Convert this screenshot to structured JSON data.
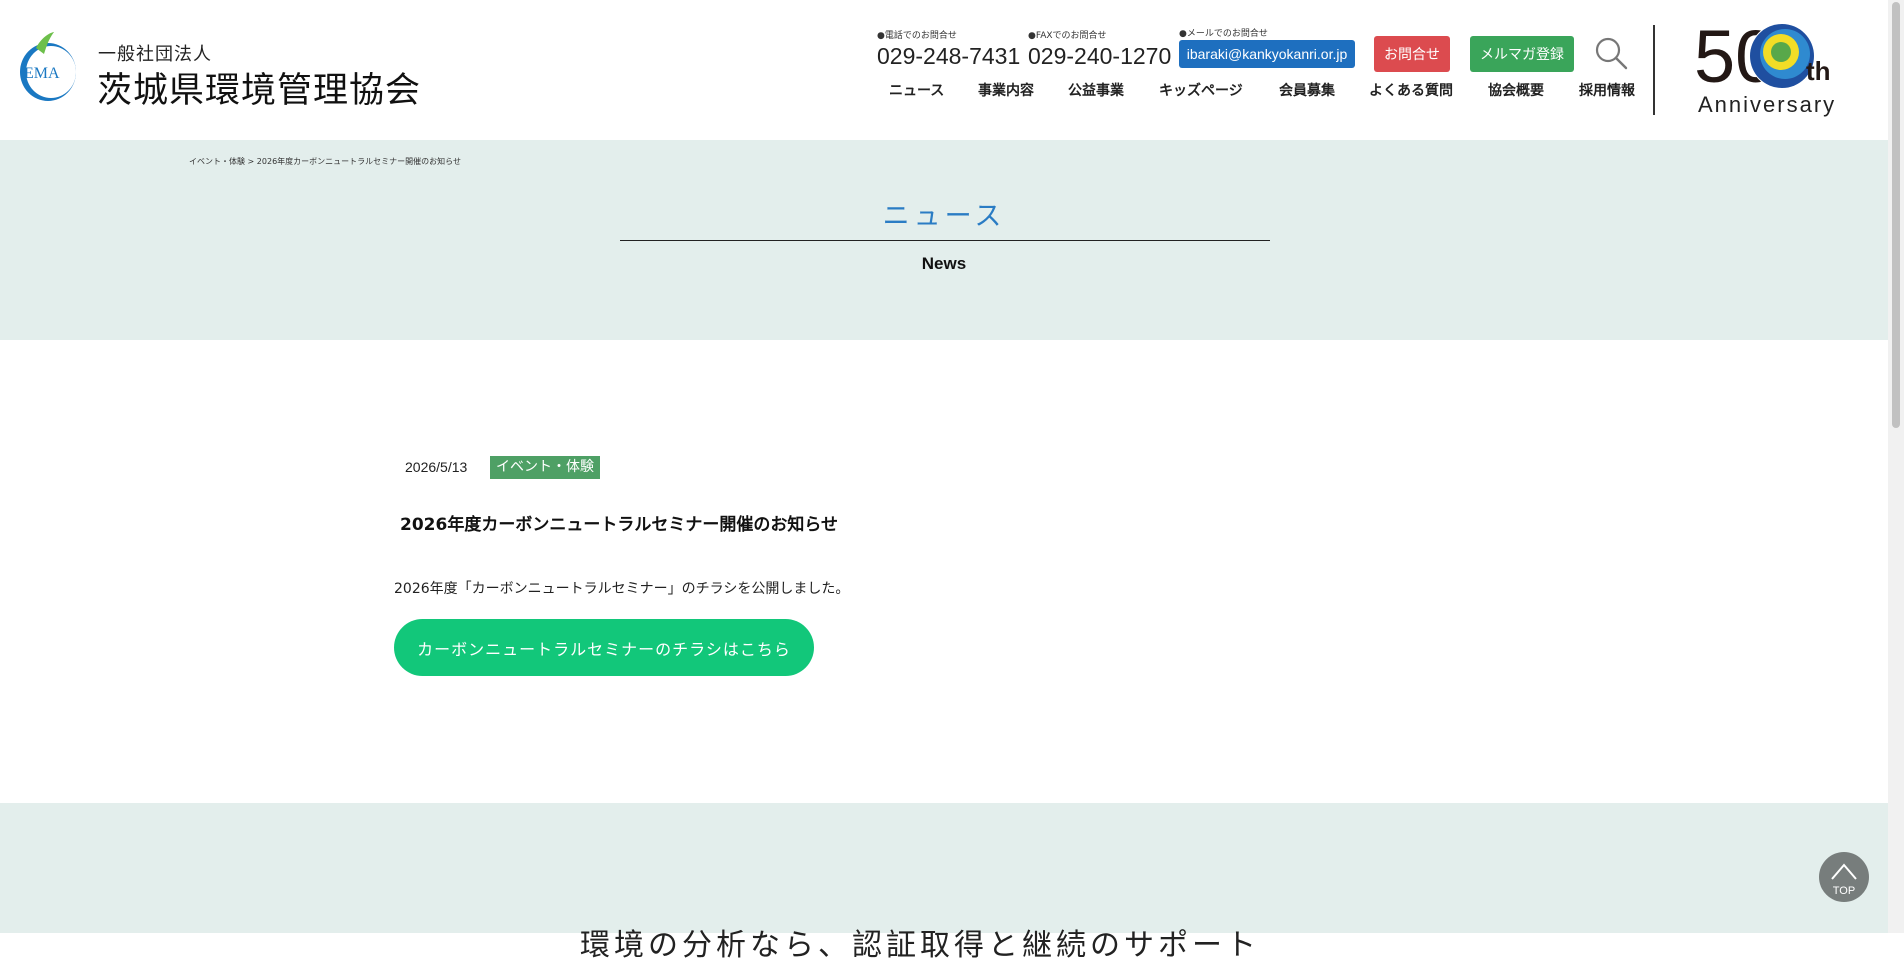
{
  "header": {
    "logo_text": "EMA",
    "org_sub": "一般社団法人",
    "org_name": "茨城県環境管理協会",
    "phone": {
      "label": "●電話でのお問合せ",
      "number": "029-248-7431"
    },
    "fax": {
      "label": "●FAXでのお問合せ",
      "number": "029-240-1270"
    },
    "mail": {
      "label": "●メールでのお問合せ",
      "address": "ibaraki@kankyokanri.or.jp"
    },
    "contact_button": "お問合せ",
    "mailmag_button": "メルマガ登録",
    "anniversary": {
      "number": "50",
      "suffix": "th",
      "word": "Anniversary"
    }
  },
  "nav": {
    "items": [
      {
        "label": "ニュース"
      },
      {
        "label": "事業内容"
      },
      {
        "label": "公益事業"
      },
      {
        "label": "キッズページ"
      },
      {
        "label": "会員募集"
      },
      {
        "label": "よくある質問"
      },
      {
        "label": "協会概要"
      },
      {
        "label": "採用情報"
      }
    ]
  },
  "breadcrumb": {
    "category": "イベント・体験",
    "separator": ">",
    "current": "2026年度カーボンニュートラルセミナー開催のお知らせ"
  },
  "page": {
    "title": "ニュース",
    "subtitle": "News"
  },
  "post": {
    "date": "2026/5/13",
    "category": "イベント・体験",
    "title": "2026年度カーボンニュートラルセミナー開催のお知らせ",
    "body": "2026年度「カーボンニュートラルセミナー」のチラシを公開しました。",
    "link_label": "カーボンニュートラルセミナーのチラシはこちら"
  },
  "footer": {
    "partial_text": "環境の分析なら、認証取得と継続のサポート"
  },
  "top_button": {
    "label": "TOP"
  },
  "colors": {
    "accent_blue": "#2a7cc4",
    "mail_button": "#1e6fbf",
    "contact_button": "#dc4b4f",
    "mailmag_button": "#3aa55a",
    "category_tag": "#4ea065",
    "cta_button": "#12c77a",
    "band_background": "#e3eeec"
  }
}
